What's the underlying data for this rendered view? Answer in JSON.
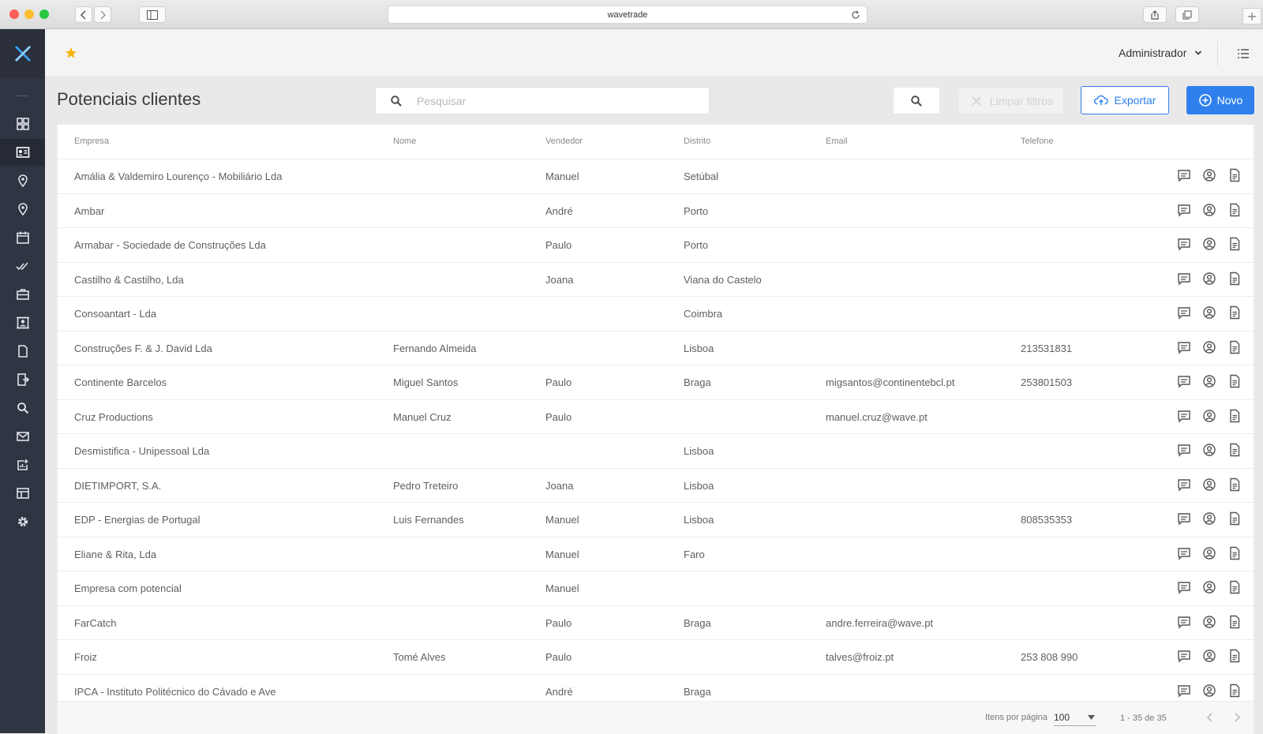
{
  "browser": {
    "url": "wavetrade"
  },
  "header": {
    "user": "Administrador"
  },
  "page": {
    "title": "Potenciais clientes"
  },
  "search": {
    "placeholder": "Pesquisar"
  },
  "toolbar": {
    "clear_label": "Limpar filtros",
    "export_label": "Exportar",
    "new_label": "Novo"
  },
  "colors": {
    "accent": "#2f80ed",
    "sidebar": "#2f3542",
    "star": "#f5b301"
  },
  "sidebar": {
    "icons": [
      "dashboard-icon",
      "contacts-card-icon",
      "location-pin-icon",
      "location-pin-icon",
      "calendar-icon",
      "double-check-icon",
      "briefcase-icon",
      "contact-book-icon",
      "document-icon",
      "export-icon",
      "search-icon",
      "mail-icon",
      "analytics-icon",
      "table-icon",
      "gear-icon"
    ]
  },
  "table": {
    "columns": {
      "empresa": "Empresa",
      "nome": "Nome",
      "vendedor": "Vendedor",
      "distrito": "Distrito",
      "email": "Email",
      "telefone": "Telefone"
    },
    "rows": [
      {
        "empresa": "Amália & Valdemiro Lourenço - Mobiliário Lda",
        "nome": "",
        "vendedor": "Manuel",
        "distrito": "Setúbal",
        "email": "",
        "telefone": ""
      },
      {
        "empresa": "Ambar",
        "nome": "",
        "vendedor": "André",
        "distrito": "Porto",
        "email": "",
        "telefone": ""
      },
      {
        "empresa": "Armabar - Sociedade de Construções Lda",
        "nome": "",
        "vendedor": "Paulo",
        "distrito": "Porto",
        "email": "",
        "telefone": ""
      },
      {
        "empresa": "Castilho & Castilho, Lda",
        "nome": "",
        "vendedor": "Joana",
        "distrito": "Viana do Castelo",
        "email": "",
        "telefone": ""
      },
      {
        "empresa": "Consoantart - Lda",
        "nome": "",
        "vendedor": "",
        "distrito": "Coimbra",
        "email": "",
        "telefone": ""
      },
      {
        "empresa": "Construções F. & J. David Lda",
        "nome": "Fernando Almeida",
        "vendedor": "",
        "distrito": "Lisboa",
        "email": "",
        "telefone": "213531831"
      },
      {
        "empresa": "Continente Barcelos",
        "nome": "Miguel Santos",
        "vendedor": "Paulo",
        "distrito": "Braga",
        "email": "migsantos@continentebcl.pt",
        "telefone": "253801503"
      },
      {
        "empresa": "Cruz Productions",
        "nome": "Manuel Cruz",
        "vendedor": "Paulo",
        "distrito": "",
        "email": "manuel.cruz@wave.pt",
        "telefone": ""
      },
      {
        "empresa": "Desmistifica - Unipessoal Lda",
        "nome": "",
        "vendedor": "",
        "distrito": "Lisboa",
        "email": "",
        "telefone": ""
      },
      {
        "empresa": "DIETIMPORT, S.A.",
        "nome": "Pedro Treteiro",
        "vendedor": "Joana",
        "distrito": "Lisboa",
        "email": "",
        "telefone": ""
      },
      {
        "empresa": "EDP - Energias de Portugal",
        "nome": "Luis Fernandes",
        "vendedor": "Manuel",
        "distrito": "Lisboa",
        "email": "",
        "telefone": "808535353"
      },
      {
        "empresa": "Eliane & Rita, Lda",
        "nome": "",
        "vendedor": "Manuel",
        "distrito": "Faro",
        "email": "",
        "telefone": ""
      },
      {
        "empresa": "Empresa com potencial",
        "nome": "",
        "vendedor": "Manuel",
        "distrito": "",
        "email": "",
        "telefone": ""
      },
      {
        "empresa": "FarCatch",
        "nome": "",
        "vendedor": "Paulo",
        "distrito": "Braga",
        "email": "andre.ferreira@wave.pt",
        "telefone": ""
      },
      {
        "empresa": "Froiz",
        "nome": "Tomé Alves",
        "vendedor": "Paulo",
        "distrito": "",
        "email": "talves@froiz.pt",
        "telefone": "253 808 990"
      },
      {
        "empresa": "IPCA - Instituto Politécnico do Cávado e Ave",
        "nome": "",
        "vendedor": "André",
        "distrito": "Braga",
        "email": "",
        "telefone": ""
      }
    ],
    "row_action_icons": [
      "comment-icon",
      "user-circle-icon",
      "document-icon"
    ]
  },
  "pagination": {
    "items_per_page_label": "Itens por página",
    "items_per_page_value": "100",
    "range": "1 - 35 de 35"
  }
}
